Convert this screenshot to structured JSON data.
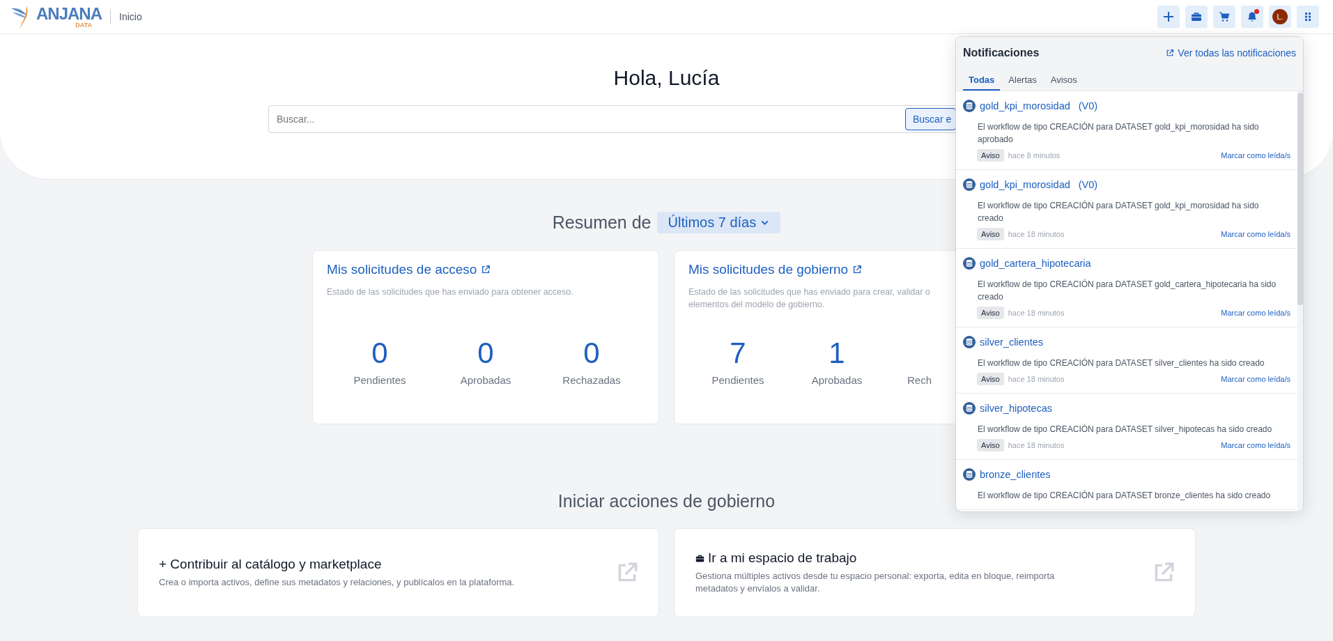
{
  "header": {
    "logo": {
      "name": "ANJANA",
      "sub": "DATA"
    },
    "page_title": "Inicio",
    "avatar": "L.",
    "unread": true
  },
  "hero": {
    "greeting": "Hola, Lucía",
    "search": {
      "placeholder": "Buscar...",
      "button": "Buscar e"
    }
  },
  "summary": {
    "label": "Resumen de",
    "period": "Últimos 7 días",
    "cards": [
      {
        "title": "Mis solicitudes de acceso",
        "description": [
          "Estado de las solicitudes que has enviado para obtener acceso."
        ],
        "stats": [
          {
            "value": "0",
            "label": "Pendientes"
          },
          {
            "value": "0",
            "label": "Aprobadas"
          },
          {
            "value": "0",
            "label": "Rechazadas"
          }
        ]
      },
      {
        "title": "Mis solicitudes de gobierno",
        "description": [
          "Estado de las solicitudes que has enviado para crear, validar o",
          "elementos del modelo de gobierno."
        ],
        "stats": [
          {
            "value": "7",
            "label": "Pendientes"
          },
          {
            "value": "1",
            "label": "Aprobadas"
          },
          {
            "label": "Rech"
          }
        ]
      }
    ]
  },
  "actions": {
    "title": "Iniciar acciones de gobierno",
    "cards": [
      {
        "kind": "plain",
        "title": "+ Contribuir al catálogo y marketplace",
        "description": "Crea o importa activos, define sus metadatos y relaciones, y publícalos en la plataforma."
      },
      {
        "kind": "briefcase",
        "title": "Ir a mi espacio de trabajo",
        "description": "Gestiona múltiples activos desde tu espacio personal: exporta, edita en bloque, reimporta metadatos y envíalos a validar."
      }
    ]
  },
  "notifications": {
    "title": "Notificaciones",
    "view_all": "Ver todas las notificaciones",
    "tabs": [
      {
        "label": "Todas",
        "selected": true
      },
      {
        "label": "Alertas",
        "selected": false
      },
      {
        "label": "Avisos",
        "selected": false
      }
    ],
    "items": [
      {
        "title": "gold_kpi_morosidad",
        "version": "(V0)",
        "message": "El workflow de tipo CREACIÓN para DATASET gold_kpi_morosidad ha sido aprobado",
        "badge": "Aviso",
        "time": "hace 8 minutos",
        "action": "Marcar como leída/s"
      },
      {
        "title": "gold_kpi_morosidad",
        "version": "(V0)",
        "message": "El workflow de tipo CREACIÓN para DATASET gold_kpi_morosidad ha sido creado",
        "badge": "Aviso",
        "time": "hace 18 minutos",
        "action": "Marcar como leída/s"
      },
      {
        "title": "gold_cartera_hipotecaria",
        "message": "El workflow de tipo CREACIÓN para DATASET gold_cartera_hipotecaria ha sido creado",
        "badge": "Aviso",
        "time": "hace 18 minutos",
        "action": "Marcar como leída/s"
      },
      {
        "title": "silver_clientes",
        "message": "El workflow de tipo CREACIÓN para DATASET silver_clientes ha sido creado",
        "badge": "Aviso",
        "time": "hace 18 minutos",
        "action": "Marcar como leída/s"
      },
      {
        "title": "silver_hipotecas",
        "message": "El workflow de tipo CREACIÓN para DATASET silver_hipotecas ha sido creado",
        "badge": "Aviso",
        "time": "hace 18 minutos",
        "action": "Marcar como leída/s"
      },
      {
        "title": "bronze_clientes",
        "message": "El workflow de tipo CREACIÓN para DATASET bronze_clientes ha sido creado"
      }
    ]
  }
}
